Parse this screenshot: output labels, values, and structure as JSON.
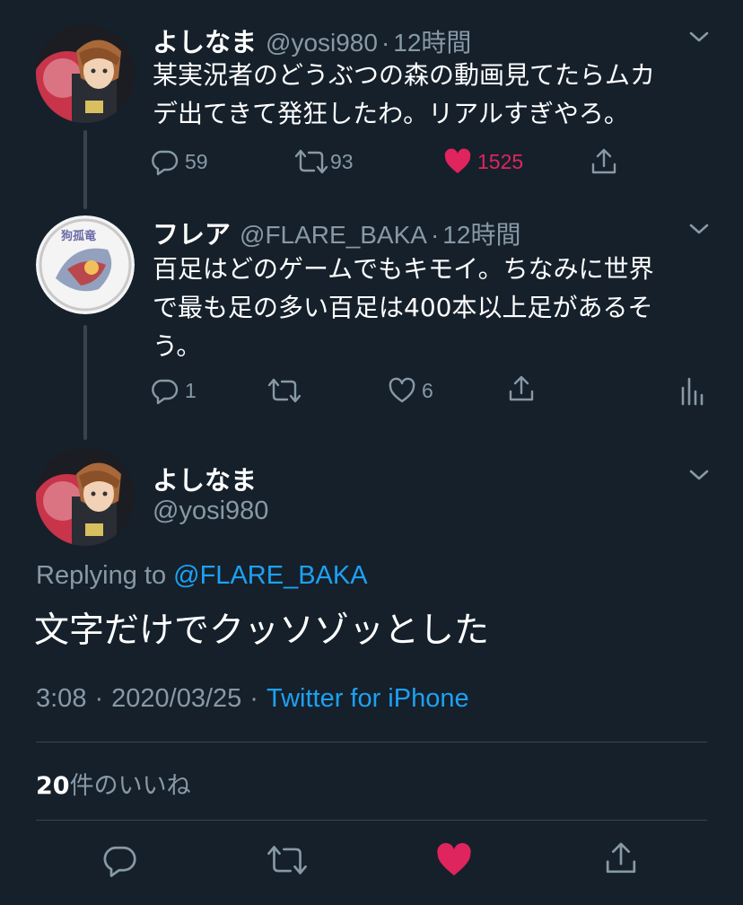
{
  "colors": {
    "background": "#15202b",
    "text": "#ffffff",
    "muted": "#8899a6",
    "accent": "#1da1f2",
    "like": "#e0245e",
    "divider": "#38444d"
  },
  "tweet1": {
    "name": "よしなま",
    "handle": "@yosi980",
    "sep": "·",
    "time": "12時間",
    "line1": "某実況者のどうぶつの森の動画見てたらムカ",
    "line2": "デ出てきて発狂したわ。リアルすぎやろ。",
    "replies": "59",
    "retweets": "93",
    "likes": "1525",
    "liked": true
  },
  "tweet2": {
    "name": "フレア",
    "handle": "@FLARE_BAKA",
    "sep": "·",
    "time": "12時間",
    "avatar_text": "狗孤竜",
    "line1": "百足はどのゲームでもキモイ。ちなみに世界",
    "line2": "で最も足の多い百足は400本以上足があるそ",
    "line3": "う。",
    "replies": "1",
    "likes": "6"
  },
  "main": {
    "name": "よしなま",
    "handle": "@yosi980",
    "replying_prefix": "Replying to",
    "replying_handle": "@FLARE_BAKA",
    "text": "文字だけでクッソゾッとした",
    "time": "3:08",
    "date": "2020/03/25",
    "sep1": "·",
    "sep2": "·",
    "source": "Twitter for iPhone",
    "likes_count": "20",
    "likes_label": "件のいいね",
    "liked": true
  },
  "icons": {
    "menu": "chevron-down-icon",
    "reply": "reply-icon",
    "retweet": "retweet-icon",
    "like": "heart-icon",
    "share": "share-icon",
    "analytics": "analytics-icon"
  }
}
